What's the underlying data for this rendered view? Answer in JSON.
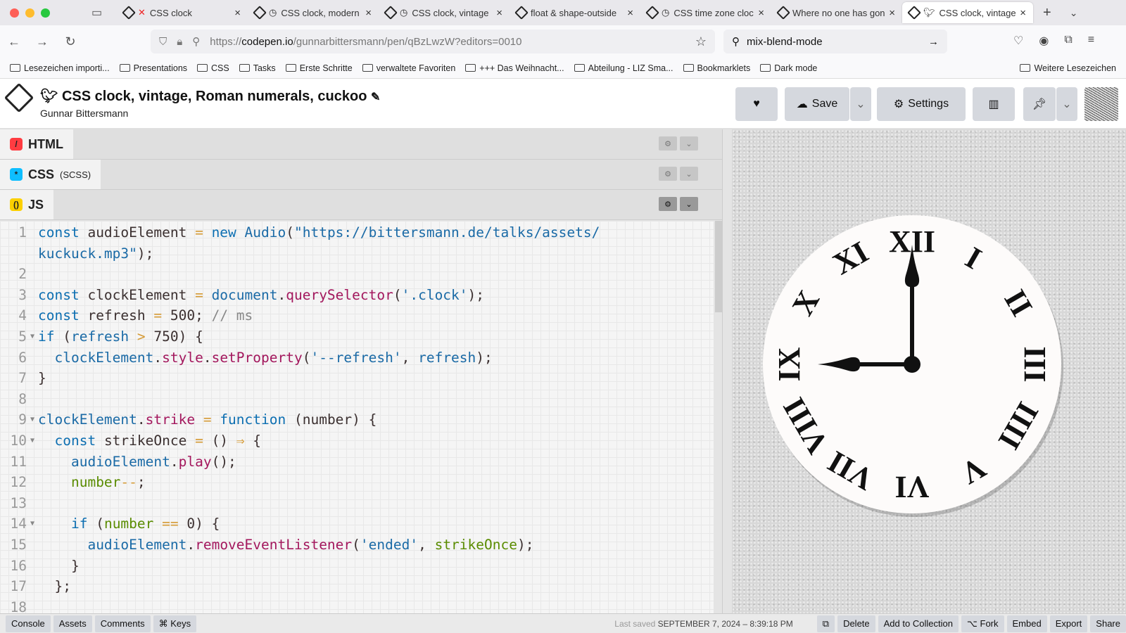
{
  "browser": {
    "tabs": [
      {
        "title": "CSS clock",
        "status": "error",
        "active": false
      },
      {
        "title": "CSS clock, modern",
        "status": "timer",
        "active": false
      },
      {
        "title": "CSS clock, vintage",
        "status": "timer",
        "active": false
      },
      {
        "title": "float & shape-outside",
        "status": "",
        "active": false
      },
      {
        "title": "CSS time zone clock",
        "status": "timer",
        "active": false
      },
      {
        "title": "Where no one has gone",
        "status": "",
        "active": false
      },
      {
        "title": "CSS clock, vintage",
        "status": "bird",
        "active": true
      }
    ],
    "url_prefix": "https://",
    "url_domain": "codepen.io",
    "url_path": "/gunnarbittersmann/pen/qBzLwzW?editors=0010",
    "search": "mix-blend-mode",
    "bookmarks": [
      "Lesezeichen importi...",
      "Presentations",
      "CSS",
      "Tasks",
      "Erste Schritte",
      "verwaltete Favoriten",
      "+++ Das Weihnacht...",
      "Abteilung - LIZ Sma...",
      "Bookmarklets",
      "Dark mode"
    ],
    "more_bookmarks": "Weitere Lesezeichen"
  },
  "pen": {
    "title": "CSS clock, vintage, Roman numerals, cuckoo",
    "author": "Gunnar Bittersmann",
    "buttons": {
      "save": "Save",
      "settings": "Settings"
    }
  },
  "editors": [
    {
      "label": "HTML",
      "sub": "",
      "color": "#ff3c41",
      "icon": "/"
    },
    {
      "label": "CSS",
      "sub": "(SCSS)",
      "color": "#0ebeff",
      "icon": "*"
    },
    {
      "label": "JS",
      "sub": "",
      "color": "#fcd000",
      "icon": "()"
    }
  ],
  "code": [
    {
      "n": "1",
      "fold": false,
      "t": [
        [
          "k",
          "const "
        ],
        [
          "v",
          "audioElement "
        ],
        [
          "o",
          "= "
        ],
        [
          "k",
          "new "
        ],
        [
          "d",
          "Audio"
        ],
        [
          "v",
          "("
        ],
        [
          "s",
          "\"https://bittersmann.de/talks/assets/"
        ]
      ]
    },
    {
      "n": "",
      "fold": false,
      "t": [
        [
          "s",
          "kuckuck.mp3\""
        ],
        [
          "v",
          ");"
        ]
      ]
    },
    {
      "n": "2",
      "fold": false,
      "t": []
    },
    {
      "n": "3",
      "fold": false,
      "t": [
        [
          "k",
          "const "
        ],
        [
          "v",
          "clockElement "
        ],
        [
          "o",
          "= "
        ],
        [
          "d",
          "document"
        ],
        [
          "v",
          "."
        ],
        [
          "p",
          "querySelector"
        ],
        [
          "v",
          "("
        ],
        [
          "s",
          "'.clock'"
        ],
        [
          "v",
          ");"
        ]
      ]
    },
    {
      "n": "4",
      "fold": false,
      "t": [
        [
          "k",
          "const "
        ],
        [
          "v",
          "refresh "
        ],
        [
          "o",
          "= "
        ],
        [
          "n",
          "500"
        ],
        [
          "v",
          "; "
        ],
        [
          "c",
          "// ms"
        ]
      ]
    },
    {
      "n": "5",
      "fold": true,
      "t": [
        [
          "k",
          "if "
        ],
        [
          "v",
          "("
        ],
        [
          "d",
          "refresh "
        ],
        [
          "o",
          "> "
        ],
        [
          "n",
          "750"
        ],
        [
          "v",
          ") {"
        ]
      ]
    },
    {
      "n": "6",
      "fold": false,
      "t": [
        [
          "v",
          "  "
        ],
        [
          "d",
          "clockElement"
        ],
        [
          "v",
          "."
        ],
        [
          "p",
          "style"
        ],
        [
          "v",
          "."
        ],
        [
          "p",
          "setProperty"
        ],
        [
          "v",
          "("
        ],
        [
          "s",
          "'--refresh'"
        ],
        [
          "v",
          ", "
        ],
        [
          "d",
          "refresh"
        ],
        [
          "v",
          ");"
        ]
      ]
    },
    {
      "n": "7",
      "fold": false,
      "t": [
        [
          "v",
          "}"
        ]
      ]
    },
    {
      "n": "8",
      "fold": false,
      "t": []
    },
    {
      "n": "9",
      "fold": true,
      "t": [
        [
          "d",
          "clockElement"
        ],
        [
          "v",
          "."
        ],
        [
          "p",
          "strike "
        ],
        [
          "o",
          "= "
        ],
        [
          "k",
          "function "
        ],
        [
          "v",
          "(number) {"
        ]
      ]
    },
    {
      "n": "10",
      "fold": true,
      "t": [
        [
          "v",
          "  "
        ],
        [
          "k",
          "const "
        ],
        [
          "v",
          "strikeOnce "
        ],
        [
          "o",
          "= "
        ],
        [
          "v",
          "() "
        ],
        [
          "o",
          "⇒ "
        ],
        [
          "v",
          "{"
        ]
      ]
    },
    {
      "n": "11",
      "fold": false,
      "t": [
        [
          "v",
          "    "
        ],
        [
          "d",
          "audioElement"
        ],
        [
          "v",
          "."
        ],
        [
          "p",
          "play"
        ],
        [
          "v",
          "();"
        ]
      ]
    },
    {
      "n": "12",
      "fold": false,
      "t": [
        [
          "v",
          "    "
        ],
        [
          "g",
          "number"
        ],
        [
          "o",
          "--"
        ],
        [
          "v",
          ";"
        ]
      ]
    },
    {
      "n": "13",
      "fold": false,
      "t": []
    },
    {
      "n": "14",
      "fold": true,
      "t": [
        [
          "v",
          "    "
        ],
        [
          "k",
          "if "
        ],
        [
          "v",
          "("
        ],
        [
          "g",
          "number "
        ],
        [
          "o",
          "== "
        ],
        [
          "n",
          "0"
        ],
        [
          "v",
          ") {"
        ]
      ]
    },
    {
      "n": "15",
      "fold": false,
      "t": [
        [
          "v",
          "      "
        ],
        [
          "d",
          "audioElement"
        ],
        [
          "v",
          "."
        ],
        [
          "p",
          "removeEventListener"
        ],
        [
          "v",
          "("
        ],
        [
          "s",
          "'ended'"
        ],
        [
          "v",
          ", "
        ],
        [
          "g",
          "strikeOnce"
        ],
        [
          "v",
          ");"
        ]
      ]
    },
    {
      "n": "16",
      "fold": false,
      "t": [
        [
          "v",
          "    }"
        ]
      ]
    },
    {
      "n": "17",
      "fold": false,
      "t": [
        [
          "v",
          "  };"
        ]
      ]
    },
    {
      "n": "18",
      "fold": false,
      "t": []
    }
  ],
  "clock": {
    "numerals": [
      "XII",
      "I",
      "II",
      "III",
      "IIII",
      "V",
      "VI",
      "VII",
      "VIII",
      "IX",
      "X",
      "XI"
    ],
    "hour": 9,
    "minute": 0
  },
  "footer": {
    "left": [
      "Console",
      "Assets",
      "Comments",
      "⌘ Keys"
    ],
    "saved_label": "Last saved",
    "saved_date": "SEPTEMBER 7, 2024 – 8:39:18 PM",
    "right": [
      "Delete",
      "Add to Collection",
      "⌥ Fork",
      "Embed",
      "Export",
      "Share"
    ]
  }
}
